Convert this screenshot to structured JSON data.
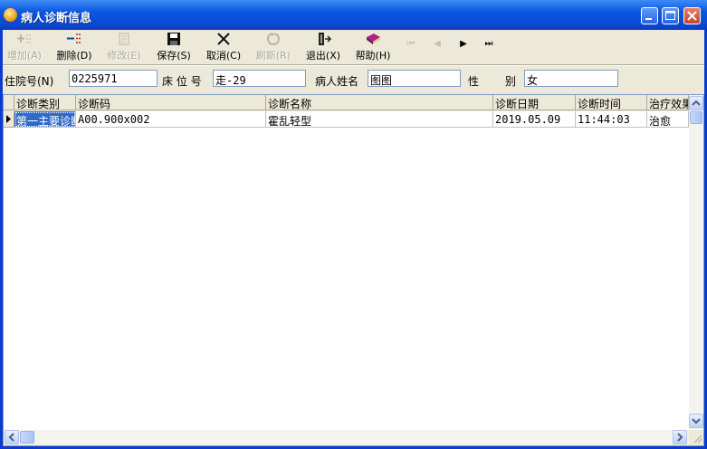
{
  "window": {
    "title": "病人诊断信息",
    "icon": "app-icon"
  },
  "toolbar": {
    "add": {
      "label": "增加(A)",
      "enabled": false,
      "icon": "add-icon"
    },
    "delete": {
      "label": "删除(D)",
      "enabled": true,
      "icon": "delete-icon"
    },
    "edit": {
      "label": "修改(E)",
      "enabled": false,
      "icon": "edit-icon"
    },
    "save": {
      "label": "保存(S)",
      "enabled": true,
      "icon": "save-icon"
    },
    "cancel": {
      "label": "取消(C)",
      "enabled": true,
      "icon": "cancel-icon"
    },
    "refresh": {
      "label": "刷新(R)",
      "enabled": false,
      "icon": "refresh-icon"
    },
    "exit": {
      "label": "退出(X)",
      "enabled": true,
      "icon": "exit-icon"
    },
    "help": {
      "label": "帮助(H)",
      "enabled": true,
      "icon": "help-book-icon"
    },
    "nav": {
      "first": "⏮",
      "prev": "◀",
      "next": "▶",
      "last": "⏭"
    }
  },
  "form": {
    "inpatient_no_label": "住院号(N)",
    "inpatient_no": "0225971",
    "bed_label": "床 位 号",
    "bed": "走-29",
    "patient_name_label": "病人姓名",
    "patient_name": "图图",
    "sex_label_1": "性",
    "sex_label_2": "别",
    "sex": "女"
  },
  "grid": {
    "columns": [
      "诊断类别",
      "诊断码",
      "诊断名称",
      "诊断日期",
      "诊断时间",
      "治疗效果"
    ],
    "rows": [
      [
        "第一主要诊断",
        "A00.900x002",
        "霍乱轻型",
        "2019.05.09",
        "11:44:03",
        "治愈"
      ]
    ]
  },
  "colors": {
    "titlebar": "#0a48d0",
    "face": "#ece9d8",
    "selection": "#316ac5"
  }
}
